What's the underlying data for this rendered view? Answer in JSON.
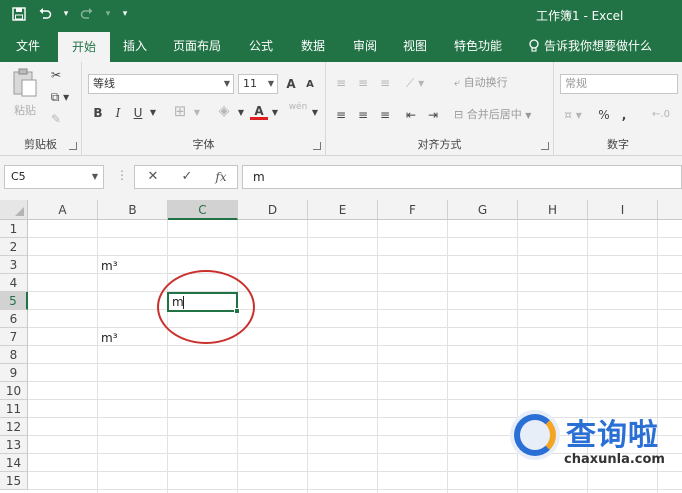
{
  "window": {
    "title": "工作簿1 - Excel"
  },
  "qat": {
    "more": "▾",
    "customize": "▾"
  },
  "tabs": [
    {
      "label": "文件"
    },
    {
      "label": "开始"
    },
    {
      "label": "插入"
    },
    {
      "label": "页面布局"
    },
    {
      "label": "公式"
    },
    {
      "label": "数据"
    },
    {
      "label": "审阅"
    },
    {
      "label": "视图"
    },
    {
      "label": "特色功能"
    }
  ],
  "tellme": {
    "label": "告诉我你想要做什么"
  },
  "ribbon": {
    "clipboard": {
      "label": "剪贴板",
      "paste": "粘贴"
    },
    "font": {
      "label": "字体",
      "family": "等线",
      "size": "11",
      "grow": "A",
      "shrink": "A",
      "bold": "B",
      "italic": "I",
      "underline": "U",
      "font_color": "A",
      "phonetic": "wén"
    },
    "alignment": {
      "label": "对齐方式",
      "wrap": "自动换行",
      "merge": "合并后居中"
    },
    "number": {
      "label": "数字",
      "format": "常规",
      "percent": "%"
    }
  },
  "formula_bar": {
    "name_box": "C5",
    "cancel": "✕",
    "enter": "✓",
    "fx": "fx",
    "content": "m"
  },
  "columns": [
    "A",
    "B",
    "C",
    "D",
    "E",
    "F",
    "G",
    "H",
    "I"
  ],
  "rows": [
    "1",
    "2",
    "3",
    "4",
    "5",
    "6",
    "7",
    "8",
    "9",
    "10",
    "11",
    "12",
    "13",
    "14",
    "15"
  ],
  "cells": {
    "B3": "m³",
    "B7": "m³",
    "C5": "m"
  },
  "watermark": {
    "brand": "查询啦",
    "url": "chaxunla.com"
  },
  "colors": {
    "accent": "#217346",
    "highlight_circle": "#c9302c"
  }
}
